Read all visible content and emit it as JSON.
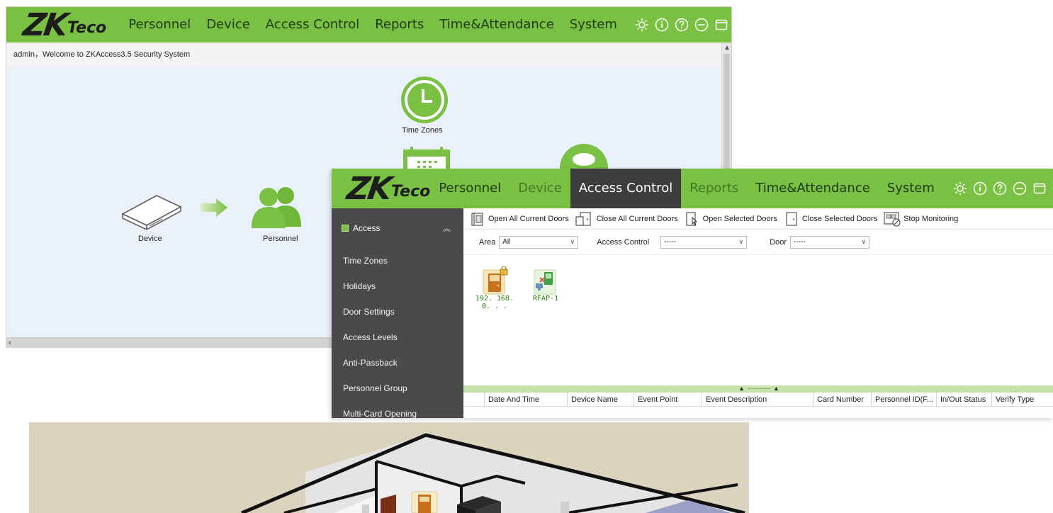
{
  "window_back": {
    "logo_main": "ZK",
    "logo_sub": "Teco",
    "menu": [
      "Personnel",
      "Device",
      "Access Control",
      "Reports",
      "Time&Attendance",
      "System"
    ],
    "welcome_text": "admin，Welcome to ZKAccess3.5 Security System",
    "flow": {
      "device": "Device",
      "personnel": "Personnel",
      "time_zones": "Time Zones"
    }
  },
  "window_front": {
    "logo_main": "ZK",
    "logo_sub": "Teco",
    "menu": [
      "Personnel",
      "Device",
      "Access Control",
      "Reports",
      "Time&Attendance",
      "System"
    ],
    "active_menu": "Access Control",
    "sidebar": {
      "header": "Access",
      "items": [
        "Time Zones",
        "Holidays",
        "Door Settings",
        "Access Levels",
        "Anti-Passback",
        "Personnel Group",
        "Multi-Card Opening"
      ]
    },
    "toolbar": {
      "open_all": "Open All Current Doors",
      "close_all": "Close All Current Doors",
      "open_selected": "Open Selected Doors",
      "close_selected": "Close Selected Doors",
      "stop_monitoring": "Stop Monitoring"
    },
    "filters": {
      "area_label": "Area",
      "area_value": "All",
      "access_control_label": "Access Control",
      "access_control_value": "-----",
      "door_label": "Door",
      "door_value": "-----"
    },
    "doors": [
      {
        "label": "192. 168. 0. . ."
      },
      {
        "label": "RFAP-1"
      }
    ],
    "table_columns": [
      "Date And Time",
      "Device Name",
      "Event Point",
      "Event Description",
      "Card Number",
      "Personnel ID(F...",
      "In/Out Status",
      "Verify Type"
    ],
    "splitter_mark": "▲ ········ ▲"
  },
  "colors": {
    "brand_green": "#7ac143",
    "active_menu_bg": "#3d3d3d",
    "sidebar_bg": "#4a4a4a",
    "floor_bg": "#dbd3bd"
  },
  "icons": {
    "settings": "gear-icon",
    "info": "info-icon",
    "help": "help-icon",
    "minimize": "minimize-icon",
    "maximize": "maximize-icon",
    "close": "close-icon"
  }
}
